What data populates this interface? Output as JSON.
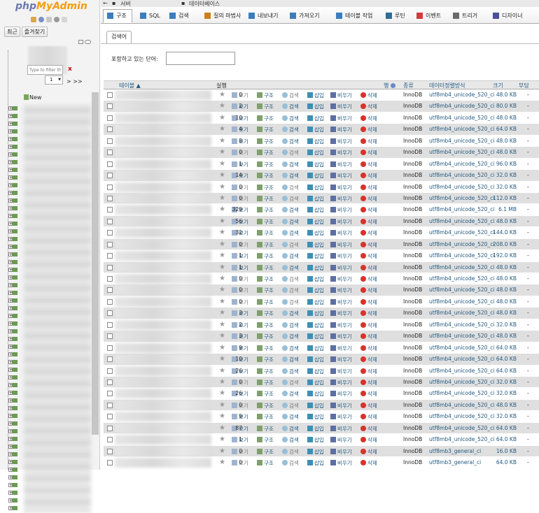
{
  "nav": {
    "logo_a": "php",
    "logo_b": "MyAdmin",
    "tabs": [
      "최근",
      "즐겨찾기"
    ],
    "filter_placeholder": "Type to filter the",
    "filter_clear": "x",
    "page_select": "1",
    "page_nav": "> >>",
    "new_label": "New"
  },
  "breadcrumb": {
    "server": "서버",
    "database": "데이터베이스"
  },
  "tabs": [
    {
      "label": "구조",
      "icon": "structure-icon"
    },
    {
      "label": "SQL",
      "icon": "sql-icon"
    },
    {
      "label": "검색",
      "icon": "search-icon"
    },
    {
      "label": "질의 마법사",
      "icon": "query-icon"
    },
    {
      "label": "내보내기",
      "icon": "export-icon"
    },
    {
      "label": "가져오기",
      "icon": "import-icon"
    },
    {
      "label": "테이블 작업",
      "icon": "operations-icon"
    },
    {
      "label": "루틴",
      "icon": "routines-icon"
    },
    {
      "label": "이벤트",
      "icon": "events-icon"
    },
    {
      "label": "트리거",
      "icon": "triggers-icon"
    },
    {
      "label": "디자이너",
      "icon": "designer-icon"
    }
  ],
  "search_panel": {
    "legend": "검색어",
    "label": "포함하고 있는 단어:"
  },
  "table": {
    "headers": {
      "table": "테이블",
      "action": "실행",
      "rows": "행",
      "type": "종류",
      "collation": "데이터정렬방식",
      "size": "크기",
      "overhead": "부담"
    },
    "actions": {
      "browse": "보기",
      "structure": "구조",
      "search": "검색",
      "insert": "삽입",
      "empty": "비우기",
      "drop": "삭제"
    },
    "rows": [
      {
        "rows": "0",
        "engine": "InnoDB",
        "collation": "utf8mb4_unicode_520_ci",
        "size": "48.0 KB",
        "overhead": "-"
      },
      {
        "rows": "2",
        "engine": "InnoDB",
        "collation": "utf8mb4_unicode_520_ci",
        "size": "80.0 KB",
        "overhead": "-"
      },
      {
        "rows": "10",
        "engine": "InnoDB",
        "collation": "utf8mb4_unicode_520_ci",
        "size": "48.0 KB",
        "overhead": "-"
      },
      {
        "rows": "4",
        "engine": "InnoDB",
        "collation": "utf8mb4_unicode_520_ci",
        "size": "64.0 KB",
        "overhead": "-"
      },
      {
        "rows": "8",
        "engine": "InnoDB",
        "collation": "utf8mb4_unicode_520_ci",
        "size": "48.0 KB",
        "overhead": "-"
      },
      {
        "rows": "0",
        "engine": "InnoDB",
        "collation": "utf8mb4_unicode_520_ci",
        "size": "48.0 KB",
        "overhead": "-"
      },
      {
        "rows": "1",
        "engine": "InnoDB",
        "collation": "utf8mb4_unicode_520_ci",
        "size": "96.0 KB",
        "overhead": "-"
      },
      {
        "rows": "14",
        "engine": "InnoDB",
        "collation": "utf8mb4_unicode_520_ci",
        "size": "32.0 KB",
        "overhead": "-"
      },
      {
        "rows": "0",
        "engine": "InnoDB",
        "collation": "utf8mb4_unicode_520_ci",
        "size": "32.0 KB",
        "overhead": "-"
      },
      {
        "rows": "0",
        "engine": "InnoDB",
        "collation": "utf8mb4_unicode_520_ci",
        "size": "112.0 KB",
        "overhead": "-"
      },
      {
        "rows": "329",
        "engine": "InnoDB",
        "collation": "utf8mb4_unicode_520_ci",
        "size": "6.1 MB",
        "overhead": "-"
      },
      {
        "rows": "56",
        "engine": "InnoDB",
        "collation": "utf8mb4_unicode_520_ci",
        "size": "48.0 KB",
        "overhead": "-"
      },
      {
        "rows": "32",
        "engine": "InnoDB",
        "collation": "utf8mb4_unicode_520_ci",
        "size": "144.0 KB",
        "overhead": "-"
      },
      {
        "rows": "0",
        "engine": "InnoDB",
        "collation": "utf8mb4_unicode_520_ci",
        "size": "208.0 KB",
        "overhead": "-"
      },
      {
        "rows": "1",
        "engine": "InnoDB",
        "collation": "utf8mb4_unicode_520_ci",
        "size": "192.0 KB",
        "overhead": "-"
      },
      {
        "rows": "1",
        "engine": "InnoDB",
        "collation": "utf8mb4_unicode_520_ci",
        "size": "48.0 KB",
        "overhead": "-"
      },
      {
        "rows": "0",
        "engine": "InnoDB",
        "collation": "utf8mb4_unicode_520_ci",
        "size": "48.0 KB",
        "overhead": "-"
      },
      {
        "rows": "0",
        "engine": "InnoDB",
        "collation": "utf8mb4_unicode_520_ci",
        "size": "48.0 KB",
        "overhead": "-"
      },
      {
        "rows": "0",
        "engine": "InnoDB",
        "collation": "utf8mb4_unicode_520_ci",
        "size": "48.0 KB",
        "overhead": "-"
      },
      {
        "rows": "3",
        "engine": "InnoDB",
        "collation": "utf8mb4_unicode_520_ci",
        "size": "48.0 KB",
        "overhead": "-"
      },
      {
        "rows": "2",
        "engine": "InnoDB",
        "collation": "utf8mb4_unicode_520_ci",
        "size": "32.0 KB",
        "overhead": "-"
      },
      {
        "rows": "3",
        "engine": "InnoDB",
        "collation": "utf8mb4_unicode_520_ci",
        "size": "48.0 KB",
        "overhead": "-"
      },
      {
        "rows": "9",
        "engine": "InnoDB",
        "collation": "utf8mb4_unicode_520_ci",
        "size": "64.0 KB",
        "overhead": "-"
      },
      {
        "rows": "10",
        "engine": "InnoDB",
        "collation": "utf8mb4_unicode_520_ci",
        "size": "64.0 KB",
        "overhead": "-"
      },
      {
        "rows": "26",
        "engine": "InnoDB",
        "collation": "utf8mb4_unicode_520_ci",
        "size": "64.0 KB",
        "overhead": "-"
      },
      {
        "rows": "0",
        "engine": "InnoDB",
        "collation": "utf8mb4_unicode_520_ci",
        "size": "32.0 KB",
        "overhead": "-"
      },
      {
        "rows": "26",
        "engine": "InnoDB",
        "collation": "utf8mb4_unicode_520_ci",
        "size": "32.0 KB",
        "overhead": "-"
      },
      {
        "rows": "0",
        "engine": "InnoDB",
        "collation": "utf8mb4_unicode_520_ci",
        "size": "48.0 KB",
        "overhead": "-"
      },
      {
        "rows": "9",
        "engine": "InnoDB",
        "collation": "utf8mb4_unicode_520_ci",
        "size": "32.0 KB",
        "overhead": "-"
      },
      {
        "rows": "87",
        "engine": "InnoDB",
        "collation": "utf8mb4_unicode_520_ci",
        "size": "64.0 KB",
        "overhead": "-"
      },
      {
        "rows": "1",
        "engine": "InnoDB",
        "collation": "utf8mb4_unicode_520_ci",
        "size": "64.0 KB",
        "overhead": "-"
      },
      {
        "rows": "0",
        "engine": "InnoDB",
        "collation": "utf8mb3_general_ci",
        "size": "16.0 KB",
        "overhead": "-"
      },
      {
        "rows": "0",
        "engine": "InnoDB",
        "collation": "utf8mb3_general_ci",
        "size": "64.0 KB",
        "overhead": "-"
      }
    ]
  }
}
